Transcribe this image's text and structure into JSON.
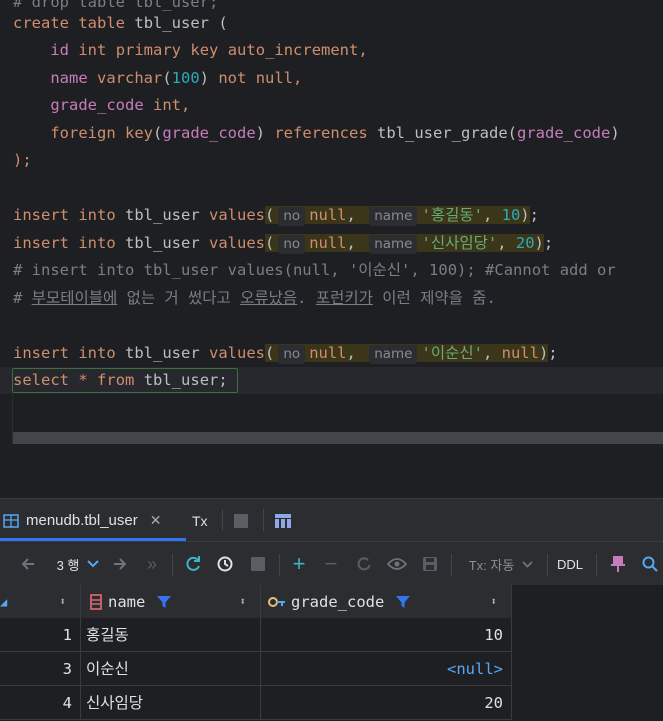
{
  "editor": {
    "line0": "# drop table tbl_user;",
    "create": "create",
    "table": "table",
    "tbl_user": "tbl_user",
    "paren_open": "(",
    "id": "id",
    "int": "int",
    "primary": "primary",
    "key": "key",
    "auto_increment": "auto_increment",
    "comma": ",",
    "name": "name",
    "varchar": "varchar",
    "n100": "100",
    "not": "not",
    "null": "null",
    "grade_code": "grade_code",
    "foreign": "foreign",
    "references": "references",
    "tbl_user_grade": "tbl_user_grade",
    "close_semicolon": ");",
    "insert": "insert",
    "into": "into",
    "values": "values",
    "hint_no": "no",
    "hint_name": "name",
    "str1": "'홍길동'",
    "v10": "10",
    "str2": "'신사임당'",
    "v20": "20",
    "comment1": "# insert into tbl_user values(null, '이순신', 100); #Cannot add or",
    "comment2_a": "# ",
    "comment2_b": "부모테이블에",
    "comment2_c": " 없는 거 썼다고 ",
    "comment2_d": "오류났음",
    "comment2_e": ". ",
    "comment2_f": "포런키가",
    "comment2_g": " 이런 제약을 줌.",
    "str3": "'이순신'",
    "select": "select",
    "star": "*",
    "from": "from"
  },
  "tabs": {
    "active_label": "menudb.tbl_user",
    "tx_label": "Tx"
  },
  "toolbar": {
    "rows_label": "3 행",
    "tx_mode": "Tx: 자동",
    "ddl": "DDL"
  },
  "grid": {
    "columns": [
      "name",
      "grade_code"
    ],
    "rows": [
      {
        "rownum": "1",
        "name": "홍길동",
        "grade_code": "10"
      },
      {
        "rownum": "3",
        "name": "이순신",
        "grade_code": "<null>"
      },
      {
        "rownum": "4",
        "name": "신사임당",
        "grade_code": "20"
      }
    ]
  },
  "colors": {
    "keyword": "#cf8e6d",
    "number": "#2aacb8",
    "string": "#6aab73",
    "accent": "#3574f0"
  }
}
